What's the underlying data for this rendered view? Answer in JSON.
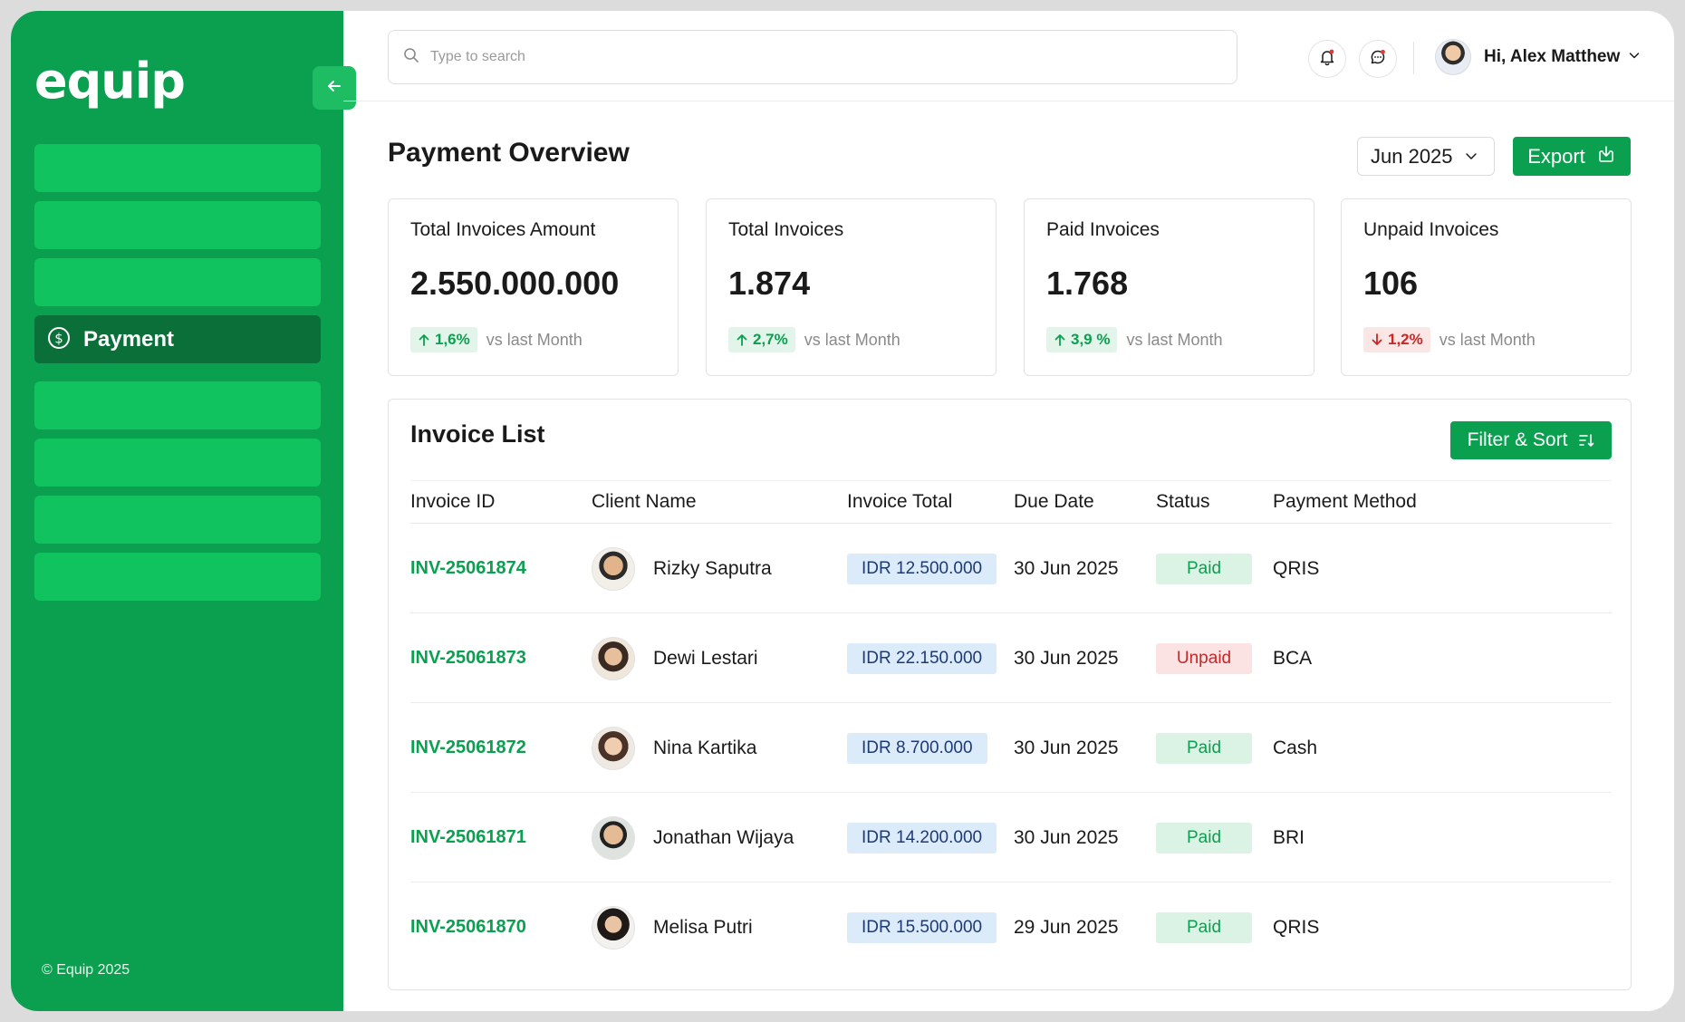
{
  "brand": {
    "logo_text": "equip",
    "accent": "#0b9f50"
  },
  "sidebar": {
    "active_item": {
      "label": "Payment",
      "icon": "dollar-circle-icon"
    },
    "footer": "© Equip 2025"
  },
  "topbar": {
    "search_placeholder": "Type to search",
    "user_greeting": "Hi, Alex Matthew"
  },
  "header": {
    "title": "Payment Overview",
    "period": "Jun 2025",
    "export_label": "Export"
  },
  "stats": [
    {
      "label": "Total Invoices Amount",
      "value": "2.550.000.000",
      "trend": "1,6%",
      "direction": "up",
      "suffix": "vs last Month"
    },
    {
      "label": "Total Invoices",
      "value": "1.874",
      "trend": "2,7%",
      "direction": "up",
      "suffix": "vs last Month"
    },
    {
      "label": "Paid Invoices",
      "value": "1.768",
      "trend": "3,9 %",
      "direction": "up",
      "suffix": "vs last Month"
    },
    {
      "label": "Unpaid Invoices",
      "value": "106",
      "trend": "1,2%",
      "direction": "down",
      "suffix": "vs last Month"
    }
  ],
  "invoices": {
    "title": "Invoice List",
    "filter_label": "Filter & Sort",
    "columns": [
      "Invoice ID",
      "Client Name",
      "Invoice Total",
      "Due Date",
      "Status",
      "Payment Method"
    ],
    "rows": [
      {
        "id": "INV-25061874",
        "client": "Rizky Saputra",
        "total": "IDR 12.500.000",
        "due": "30 Jun 2025",
        "status": "Paid",
        "method": "QRIS"
      },
      {
        "id": "INV-25061873",
        "client": "Dewi Lestari",
        "total": "IDR 22.150.000",
        "due": "30 Jun 2025",
        "status": "Unpaid",
        "method": "BCA"
      },
      {
        "id": "INV-25061872",
        "client": "Nina Kartika",
        "total": "IDR 8.700.000",
        "due": "30 Jun 2025",
        "status": "Paid",
        "method": "Cash"
      },
      {
        "id": "INV-25061871",
        "client": "Jonathan Wijaya",
        "total": "IDR 14.200.000",
        "due": "30 Jun 2025",
        "status": "Paid",
        "method": "BRI"
      },
      {
        "id": "INV-25061870",
        "client": "Melisa Putri",
        "total": "IDR 15.500.000",
        "due": "29 Jun 2025",
        "status": "Paid",
        "method": "QRIS"
      }
    ]
  }
}
